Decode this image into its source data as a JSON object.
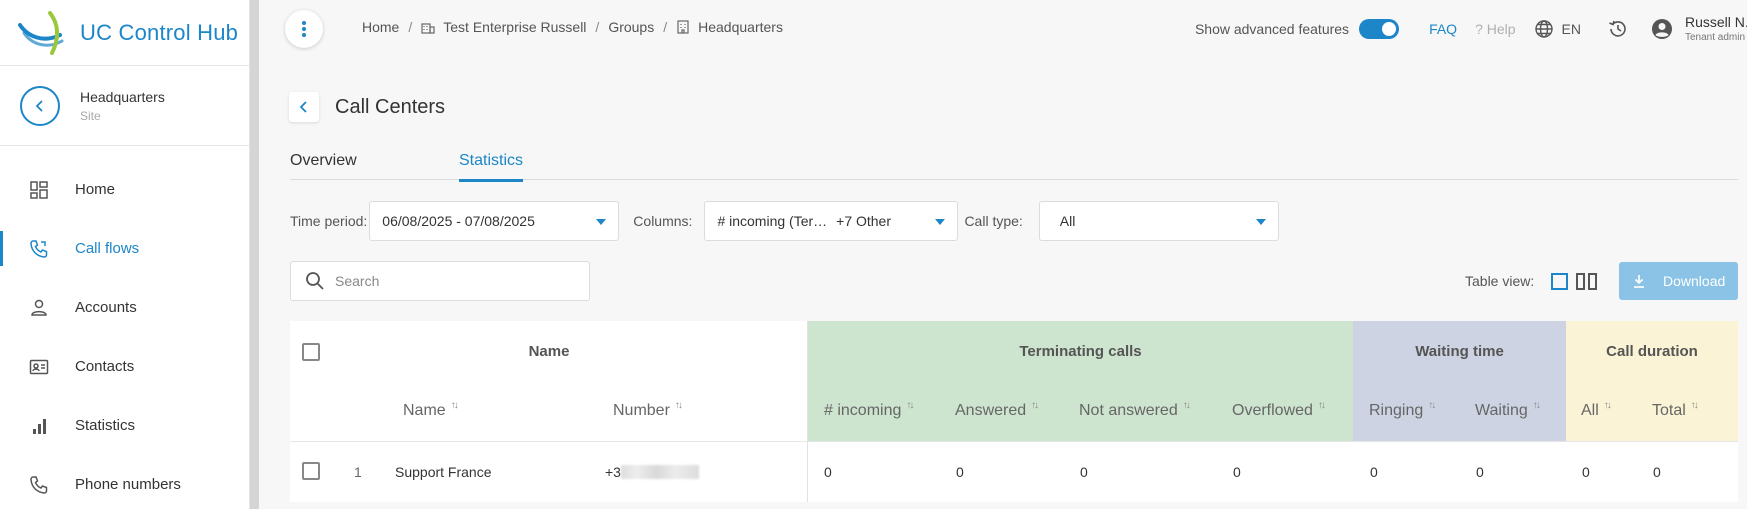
{
  "brand": {
    "name": "UC Control Hub"
  },
  "site": {
    "name": "Headquarters",
    "type": "Site"
  },
  "nav": [
    {
      "label": "Home",
      "icon": "dashboard-icon",
      "active": false
    },
    {
      "label": "Call flows",
      "icon": "call-flow-icon",
      "active": true
    },
    {
      "label": "Accounts",
      "icon": "person-icon",
      "active": false
    },
    {
      "label": "Contacts",
      "icon": "contact-card-icon",
      "active": false
    },
    {
      "label": "Statistics",
      "icon": "bar-chart-icon",
      "active": false
    },
    {
      "label": "Phone numbers",
      "icon": "phone-icon",
      "active": false
    }
  ],
  "breadcrumb": {
    "home": "Home",
    "enterprise": "Test Enterprise Russell",
    "groups": "Groups",
    "current": "Headquarters"
  },
  "header": {
    "advanced_label": "Show advanced features",
    "advanced_on": true,
    "faq": "FAQ",
    "help": "? Help",
    "language": "EN",
    "user_name": "Russell N.",
    "user_role": "Tenant admin"
  },
  "page": {
    "title": "Call Centers"
  },
  "tabs": [
    {
      "label": "Overview",
      "active": false
    },
    {
      "label": "Statistics",
      "active": true
    }
  ],
  "filters": {
    "time_label": "Time period:",
    "time_value": "06/08/2025 - 07/08/2025",
    "columns_label": "Columns:",
    "columns_value": "# incoming (Ter…",
    "columns_more": "+7 Other",
    "calltype_label": "Call type:",
    "calltype_value": "All"
  },
  "search": {
    "placeholder": "Search"
  },
  "table_view": {
    "label": "Table view:"
  },
  "download": {
    "label": "Download"
  },
  "table": {
    "groups": {
      "name": "Name",
      "terminating": "Terminating calls",
      "waiting": "Waiting time",
      "duration": "Call duration"
    },
    "columns": {
      "name": "Name",
      "number": "Number",
      "incoming": "# incoming",
      "answered": "Answered",
      "not_answered": "Not answered",
      "overflowed": "Overflowed",
      "ringing": "Ringing",
      "waiting": "Waiting",
      "all": "All",
      "total": "Total"
    },
    "sort_glyph": "↑↓",
    "rows": [
      {
        "index": "1",
        "name": "Support France",
        "number": "+3",
        "incoming": "0",
        "answered": "0",
        "not_answered": "0",
        "overflowed": "0",
        "ringing": "0",
        "waiting": "0",
        "all": "0",
        "total": "0"
      }
    ]
  },
  "colors": {
    "accent": "#1c86c8",
    "terminating_bg": "#cde4cf",
    "waiting_bg": "#cdd3e2",
    "duration_bg": "#fbf3d6"
  }
}
